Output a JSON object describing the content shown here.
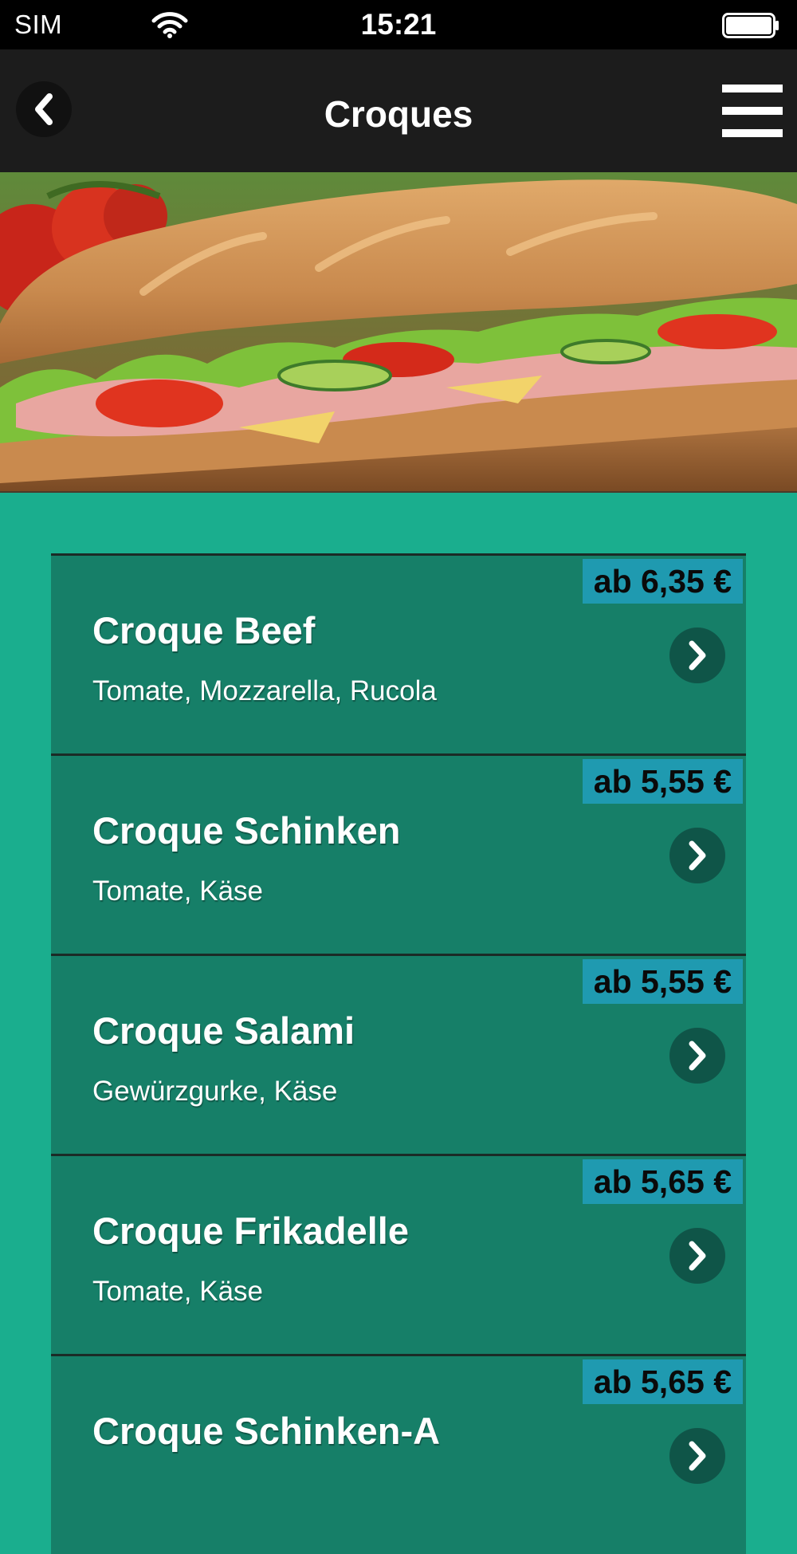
{
  "status_bar": {
    "carrier": "SIM",
    "time": "15:21",
    "wifi_icon": "wifi-icon",
    "battery_icon": "battery-full-icon"
  },
  "nav_bar": {
    "title": "Croques",
    "back_icon": "chevron-left-icon",
    "menu_icon": "hamburger-menu-icon"
  },
  "hero": {
    "image": "baguette-sandwich-photo"
  },
  "products": [
    {
      "name": "Croque Beef",
      "description": "Tomate, Mozzarella, Rucola",
      "price": "ab 6,35 €"
    },
    {
      "name": "Croque Schinken",
      "description": "Tomate, Käse",
      "price": "ab 5,55 €"
    },
    {
      "name": "Croque Salami",
      "description": "Gewürzgurke, Käse",
      "price": "ab 5,55 €"
    },
    {
      "name": "Croque Frikadelle",
      "description": "Tomate, Käse",
      "price": "ab 5,65 €"
    },
    {
      "name": "Croque Schinken-A",
      "description": "",
      "price": "ab 5,65 €"
    }
  ],
  "colors": {
    "background": "#1aae8e",
    "item_background": "#167f68",
    "price_badge": "#1f9ab0",
    "nav_bar": "#1c1c1c",
    "chevron_circle": "#0f5548"
  }
}
